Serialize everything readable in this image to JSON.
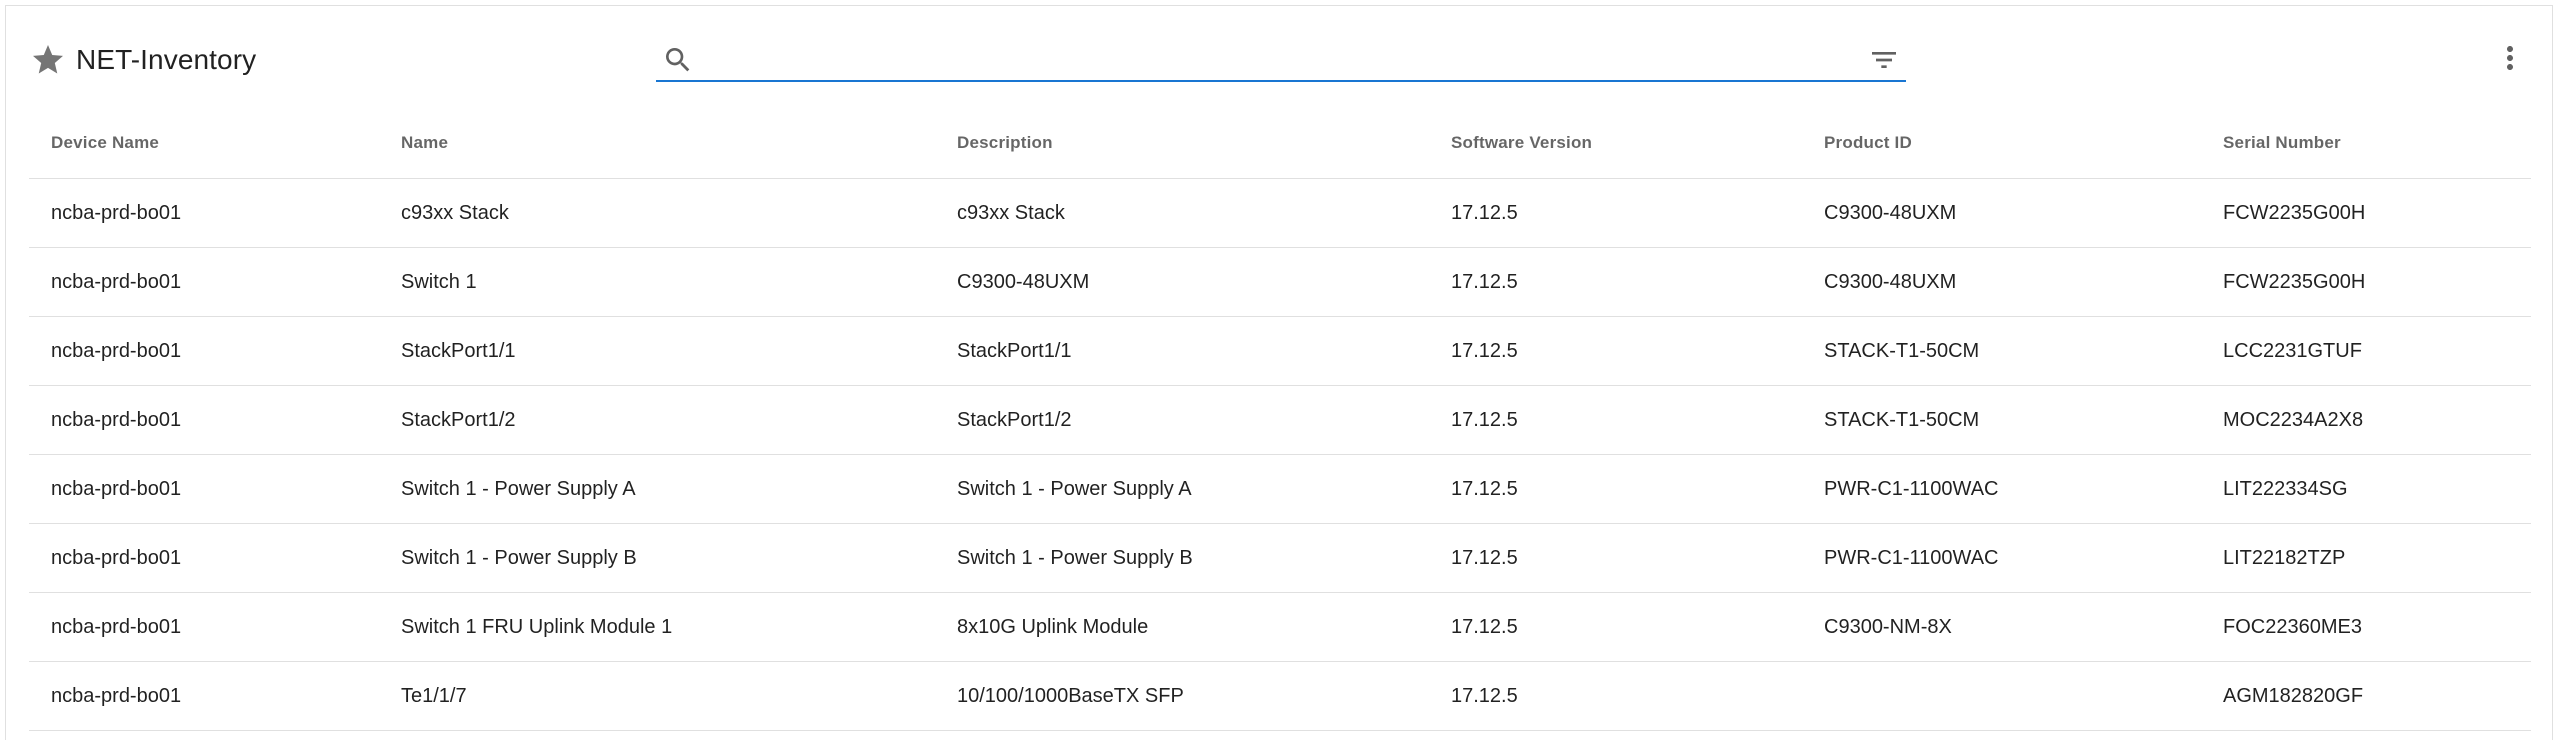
{
  "header": {
    "title": "NET-Inventory",
    "search": {
      "value": "",
      "placeholder": ""
    }
  },
  "colors": {
    "accent": "#1976d2",
    "icon": "#757575",
    "border": "#e0e0e0"
  },
  "icons": {
    "favorite": "star-icon",
    "search": "search-icon",
    "filter": "filter-list-icon",
    "more": "more-vert-icon"
  },
  "table": {
    "columns": [
      "Device Name",
      "Name",
      "Description",
      "Software Version",
      "Product ID",
      "Serial Number"
    ],
    "rows": [
      [
        "ncba-prd-bo01",
        "c93xx Stack",
        "c93xx Stack",
        "17.12.5",
        "C9300-48UXM",
        "FCW2235G00H"
      ],
      [
        "ncba-prd-bo01",
        "Switch 1",
        "C9300-48UXM",
        "17.12.5",
        "C9300-48UXM",
        "FCW2235G00H"
      ],
      [
        "ncba-prd-bo01",
        "StackPort1/1",
        "StackPort1/1",
        "17.12.5",
        "STACK-T1-50CM",
        "LCC2231GTUF"
      ],
      [
        "ncba-prd-bo01",
        "StackPort1/2",
        "StackPort1/2",
        "17.12.5",
        "STACK-T1-50CM",
        "MOC2234A2X8"
      ],
      [
        "ncba-prd-bo01",
        "Switch 1 - Power Supply A",
        "Switch 1 - Power Supply A",
        "17.12.5",
        "PWR-C1-1100WAC",
        "LIT222334SG"
      ],
      [
        "ncba-prd-bo01",
        "Switch 1 - Power Supply B",
        "Switch 1 - Power Supply B",
        "17.12.5",
        "PWR-C1-1100WAC",
        "LIT22182TZP"
      ],
      [
        "ncba-prd-bo01",
        "Switch 1 FRU Uplink Module 1",
        "8x10G Uplink Module",
        "17.12.5",
        "C9300-NM-8X",
        "FOC22360ME3"
      ],
      [
        "ncba-prd-bo01",
        "Te1/1/7",
        "10/100/1000BaseTX SFP",
        "17.12.5",
        "",
        "AGM182820GF"
      ]
    ]
  }
}
